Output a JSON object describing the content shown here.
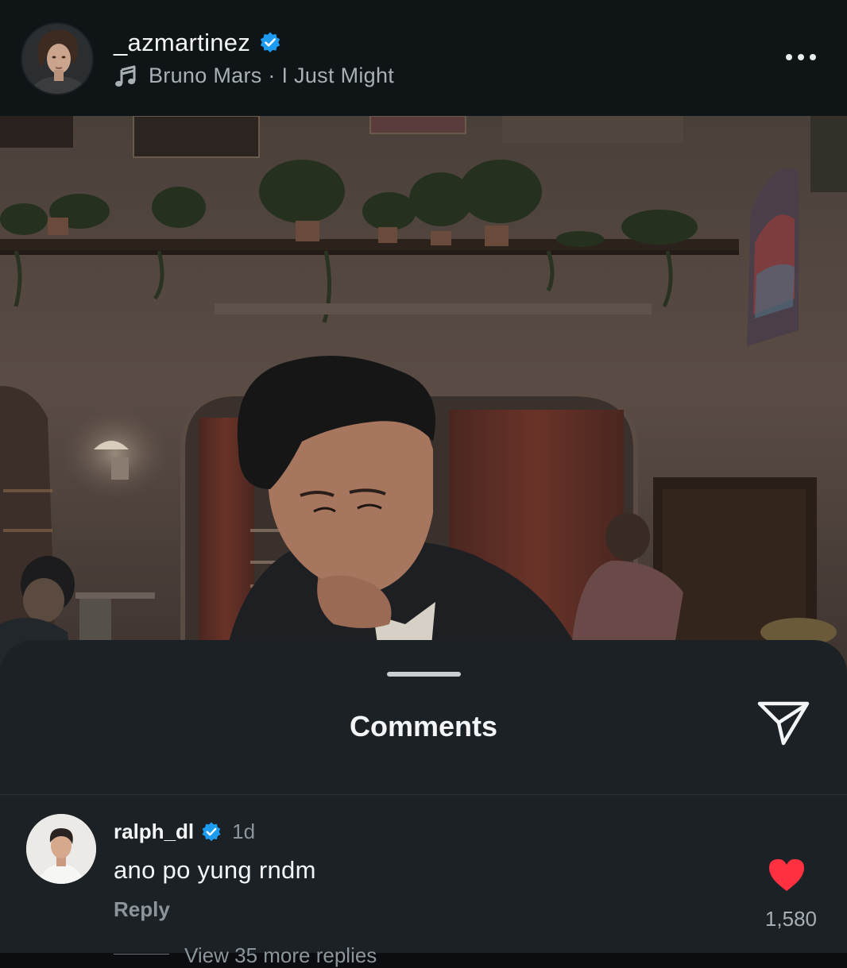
{
  "header": {
    "username": "_azmartinez",
    "music_text": "Bruno Mars · I Just Might",
    "icons": {
      "verified": "verified-badge-icon",
      "music": "music-note-icon",
      "more": "more-horizontal-icon"
    }
  },
  "photo": {
    "description_icon": "post-photo"
  },
  "comments_sheet": {
    "title": "Comments",
    "icons": {
      "share": "send-icon"
    }
  },
  "comment": {
    "username": "ralph_dl",
    "time": "1d",
    "text": "ano po yung rndm",
    "reply_label": "Reply",
    "likes": "1,580",
    "view_more": "View 35 more replies",
    "icons": {
      "verified": "verified-badge-icon",
      "like": "heart-filled-icon"
    },
    "colors": {
      "heart": "#ff3040"
    }
  },
  "colors": {
    "background": "#0f1417",
    "sheet": "#1b2125",
    "verified": "#1d9bf0"
  }
}
